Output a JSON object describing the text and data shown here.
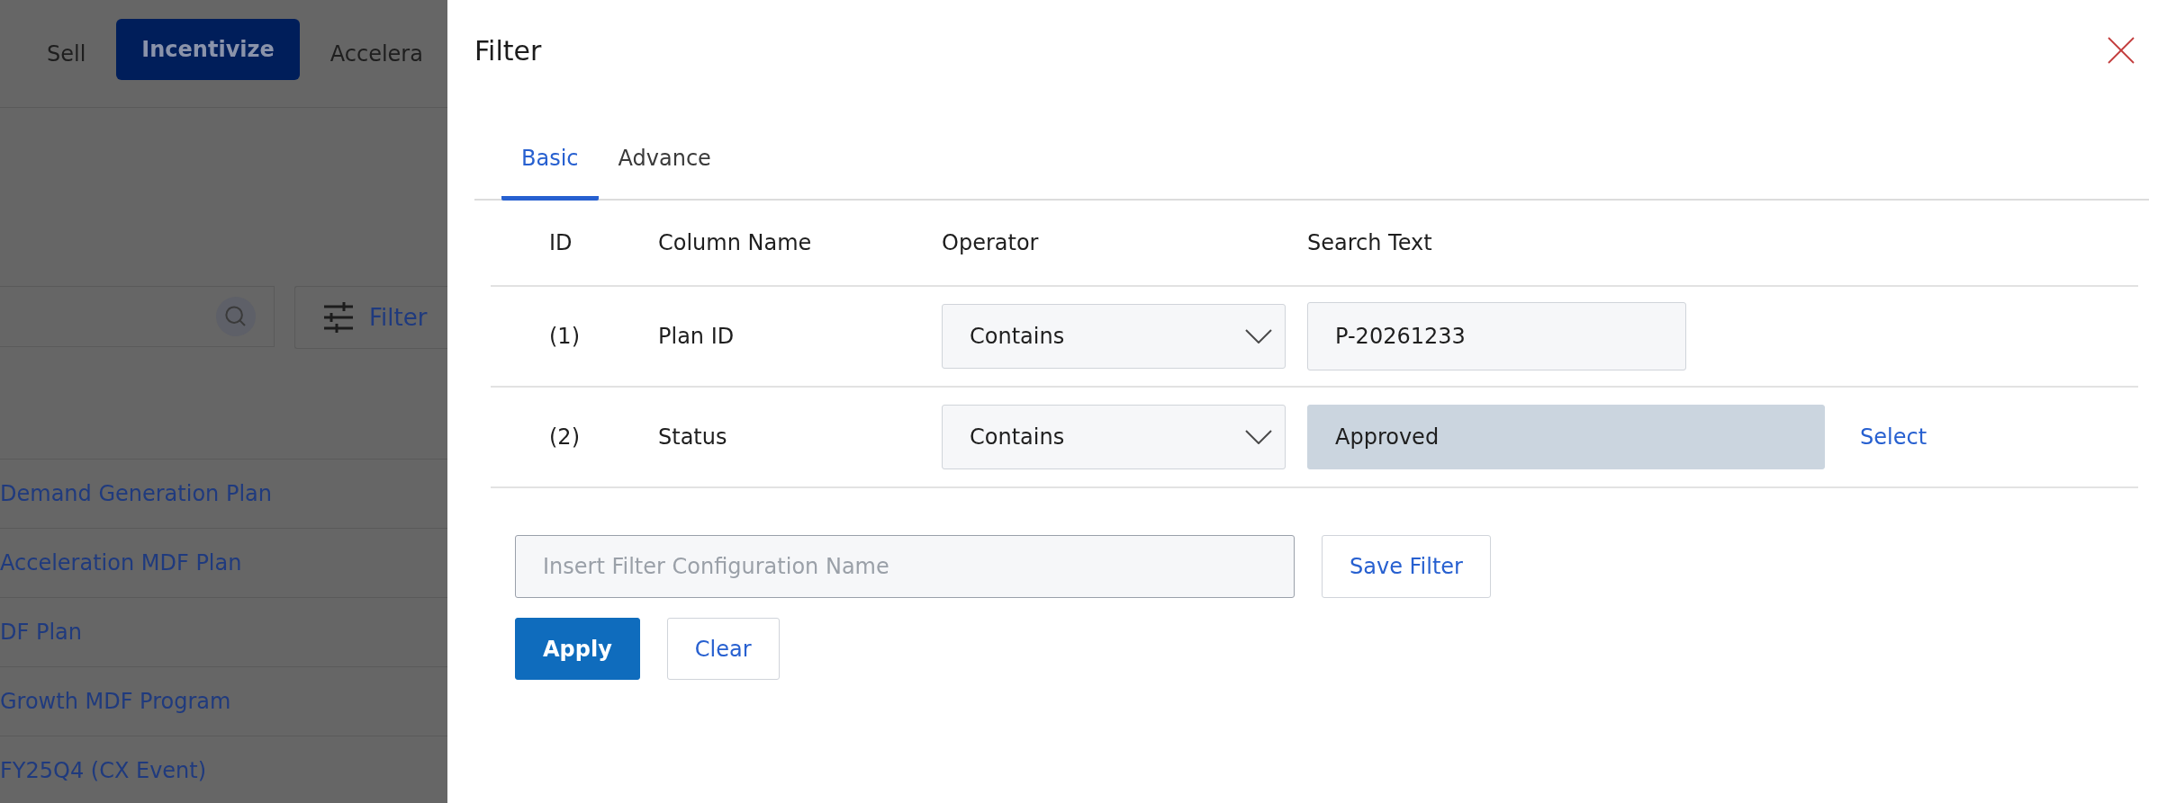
{
  "background": {
    "nav": [
      {
        "label": "Sell",
        "selected": false
      },
      {
        "label": "Incentivize",
        "selected": true
      },
      {
        "label": "Accelera",
        "selected": false
      }
    ],
    "filter_button": "Filter",
    "rows": [
      "Demand Generation Plan",
      "Acceleration MDF Plan",
      "DF Plan",
      "Growth MDF Program",
      "FY25Q4 (CX Event)"
    ]
  },
  "dialog": {
    "title": "Filter",
    "tabs": [
      {
        "label": "Basic",
        "selected": true
      },
      {
        "label": "Advance",
        "selected": false
      }
    ],
    "columns": [
      "ID",
      "Column Name",
      "Operator",
      "Search Text"
    ],
    "rows": [
      {
        "id": "(1)",
        "column": "Plan ID",
        "operator": "Contains",
        "value": "P-20261233",
        "kind": "text"
      },
      {
        "id": "(2)",
        "column": "Status",
        "operator": "Contains",
        "value": "Approved",
        "kind": "lookup",
        "action": "Select"
      }
    ],
    "config_name": {
      "placeholder": "Insert Filter Configuration Name"
    },
    "save_button": "Save Filter",
    "buttons": [
      {
        "label": "Apply",
        "kind": "primary"
      },
      {
        "label": "Clear",
        "kind": "secondary"
      }
    ]
  }
}
